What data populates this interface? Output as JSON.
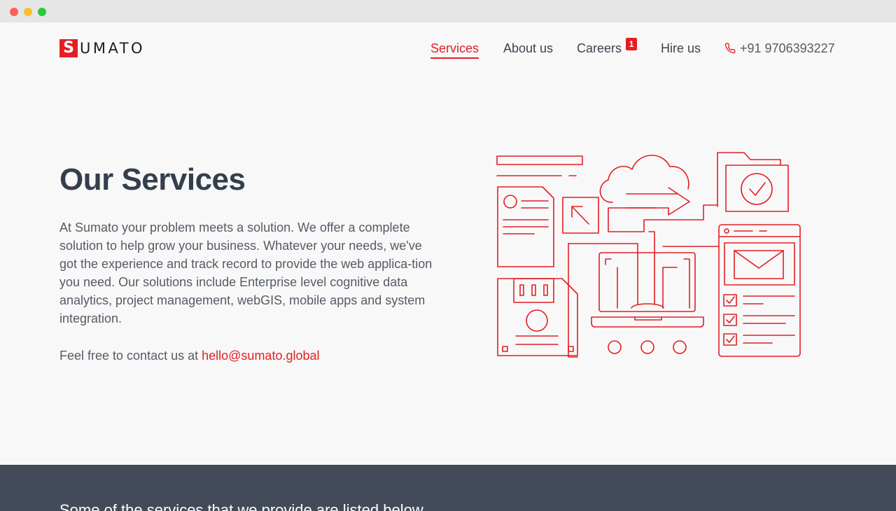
{
  "window": {
    "controls": [
      "close",
      "minimize",
      "maximize"
    ]
  },
  "brand": {
    "logo_letter": "S",
    "logo_rest": "UMATO"
  },
  "nav": {
    "items": [
      {
        "label": "Services",
        "active": true
      },
      {
        "label": "About us",
        "active": false
      },
      {
        "label": "Careers",
        "badge": "1",
        "active": false
      },
      {
        "label": "Hire us",
        "active": false
      }
    ],
    "phone": "+91 9706393227"
  },
  "hero": {
    "title": "Our Services",
    "description": "At Sumato your problem meets a solution. We offer a complete solution to help grow your business. Whatever your needs, we've got the experience and track record to provide the web applica-tion you need. Our solutions include Enterprise level cognitive data analytics, project management, webGIS, mobile apps and system integration.",
    "contact_prefix": "Feel free to contact us at",
    "contact_email": "hello@sumato.global"
  },
  "services_section": {
    "intro": "Some of the services that we provide are listed below"
  },
  "colors": {
    "accent": "#e31e24",
    "heading": "#343f4c",
    "dark_section": "#434b5b"
  }
}
